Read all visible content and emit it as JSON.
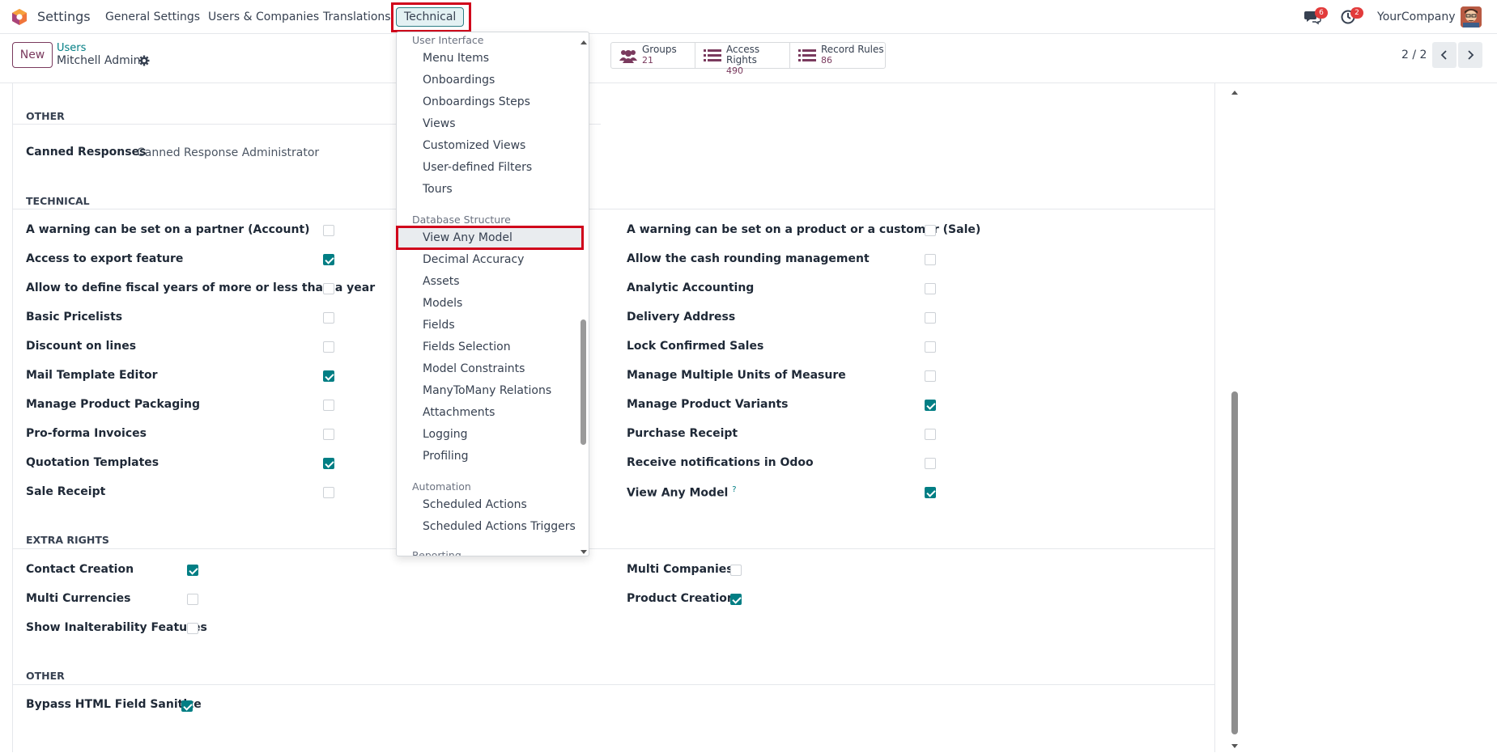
{
  "navbar": {
    "app_title": "Settings",
    "menus": [
      "General Settings",
      "Users & Companies",
      "Translations"
    ],
    "active_menu": "Technical",
    "messages_badge": "6",
    "activities_badge": "2",
    "company": "YourCompany"
  },
  "control_panel": {
    "new_label": "New",
    "breadcrumb_parent": "Users",
    "breadcrumb_current": "Mitchell Admin",
    "smart_buttons": [
      {
        "label": "Groups",
        "value": "21"
      },
      {
        "label": "Access Rights",
        "value": "490"
      },
      {
        "label": "Record Rules",
        "value": "86"
      }
    ],
    "pager": "2 / 2"
  },
  "form": {
    "other_top": {
      "title": "OTHER",
      "field_label": "Canned Responses",
      "field_value": "Canned Response Administrator"
    },
    "technical": {
      "title": "TECHNICAL",
      "left": [
        {
          "label": "A warning can be set on a partner (Account)",
          "checked": false
        },
        {
          "label": "Access to export feature",
          "checked": true
        },
        {
          "label": "Allow to define fiscal years of more or less than a year",
          "checked": false
        },
        {
          "label": "Basic Pricelists",
          "checked": false
        },
        {
          "label": "Discount on lines",
          "checked": false
        },
        {
          "label": "Mail Template Editor",
          "checked": true
        },
        {
          "label": "Manage Product Packaging",
          "checked": false
        },
        {
          "label": "Pro-forma Invoices",
          "checked": false
        },
        {
          "label": "Quotation Templates",
          "checked": true
        },
        {
          "label": "Sale Receipt",
          "checked": false
        }
      ],
      "right": [
        {
          "label": "A warning can be set on a product or a customer (Sale)",
          "checked": false
        },
        {
          "label": "Allow the cash rounding management",
          "checked": false
        },
        {
          "label": "Analytic Accounting",
          "checked": false
        },
        {
          "label": "Delivery Address",
          "checked": false
        },
        {
          "label": "Lock Confirmed Sales",
          "checked": false
        },
        {
          "label": "Manage Multiple Units of Measure",
          "checked": false
        },
        {
          "label": "Manage Product Variants",
          "checked": true
        },
        {
          "label": "Purchase Receipt",
          "checked": false
        },
        {
          "label": "Receive notifications in Odoo",
          "checked": false
        },
        {
          "label": "View Any Model",
          "checked": true,
          "help": "?"
        }
      ]
    },
    "extra_rights": {
      "title": "EXTRA RIGHTS",
      "left": [
        {
          "label": "Contact Creation",
          "checked": true
        },
        {
          "label": "Multi Currencies",
          "checked": false
        },
        {
          "label": "Show Inalterability Features",
          "checked": false
        }
      ],
      "right": [
        {
          "label": "Multi Companies",
          "checked": false
        },
        {
          "label": "Product Creation",
          "checked": true
        }
      ]
    },
    "other_bottom": {
      "title": "OTHER",
      "items": [
        {
          "label": "Bypass HTML Field Sanitize",
          "checked": true
        }
      ]
    }
  },
  "dropdown": {
    "sections": [
      {
        "header": "User Interface",
        "items": [
          "Menu Items",
          "Onboardings",
          "Onboardings Steps",
          "Views",
          "Customized Views",
          "User-defined Filters",
          "Tours"
        ]
      },
      {
        "header": "Database Structure",
        "items": [
          "View Any Model",
          "Decimal Accuracy",
          "Assets",
          "Models",
          "Fields",
          "Fields Selection",
          "Model Constraints",
          "ManyToMany Relations",
          "Attachments",
          "Logging",
          "Profiling"
        ]
      },
      {
        "header": "Automation",
        "items": [
          "Scheduled Actions",
          "Scheduled Actions Triggers"
        ]
      },
      {
        "header": "Reporting",
        "items": []
      }
    ],
    "highlighted_item": "View Any Model"
  },
  "colors": {
    "primary": "#7a3a5e",
    "teal": "#017e84",
    "annotation_red": "#d0021b",
    "badge_red": "#e23b3b"
  }
}
